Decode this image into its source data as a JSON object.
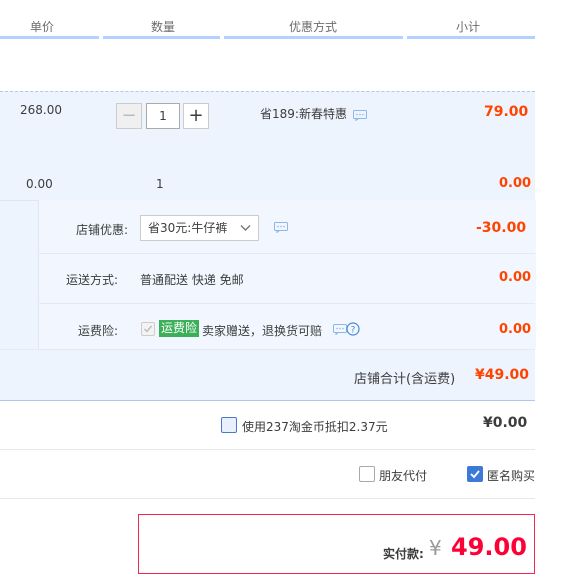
{
  "header": {
    "unit_price": "单价",
    "quantity": "数量",
    "discount": "优惠方式",
    "subtotal": "小计"
  },
  "item": {
    "unit_price": "268.00",
    "quantity_value": "1",
    "discount_text": "省189:新春特惠",
    "subtotal": "79.00"
  },
  "item2": {
    "unit_price": "0.00",
    "quantity": "1",
    "subtotal": "0.00"
  },
  "shop": {
    "discount_label": "店铺优惠:",
    "discount_selected": "省30元:牛仔裤",
    "discount_amount": "-30.00",
    "shipping_label": "运送方式:",
    "shipping_text": "普通配送 快递 免邮",
    "shipping_amount": "0.00",
    "insurance_label": "运费险:",
    "insurance_tag": "运费险",
    "insurance_text": "卖家赠送，退换货可赔",
    "insurance_amount": "0.00",
    "total_label": "店铺合计(含运费)",
    "total_amount": "¥49.00"
  },
  "coins": {
    "label": "使用237淘金币抵扣2.37元",
    "amount": "¥0.00"
  },
  "options": {
    "friend_pay": "朋友代付",
    "anonymous": "匿名购买"
  },
  "payment": {
    "label": "实付款:",
    "currency": "¥",
    "amount": "49.00"
  },
  "colors": {
    "price_red": "#ff0036",
    "accent_blue": "#3d7ad7",
    "green_tag": "#3bb058"
  }
}
